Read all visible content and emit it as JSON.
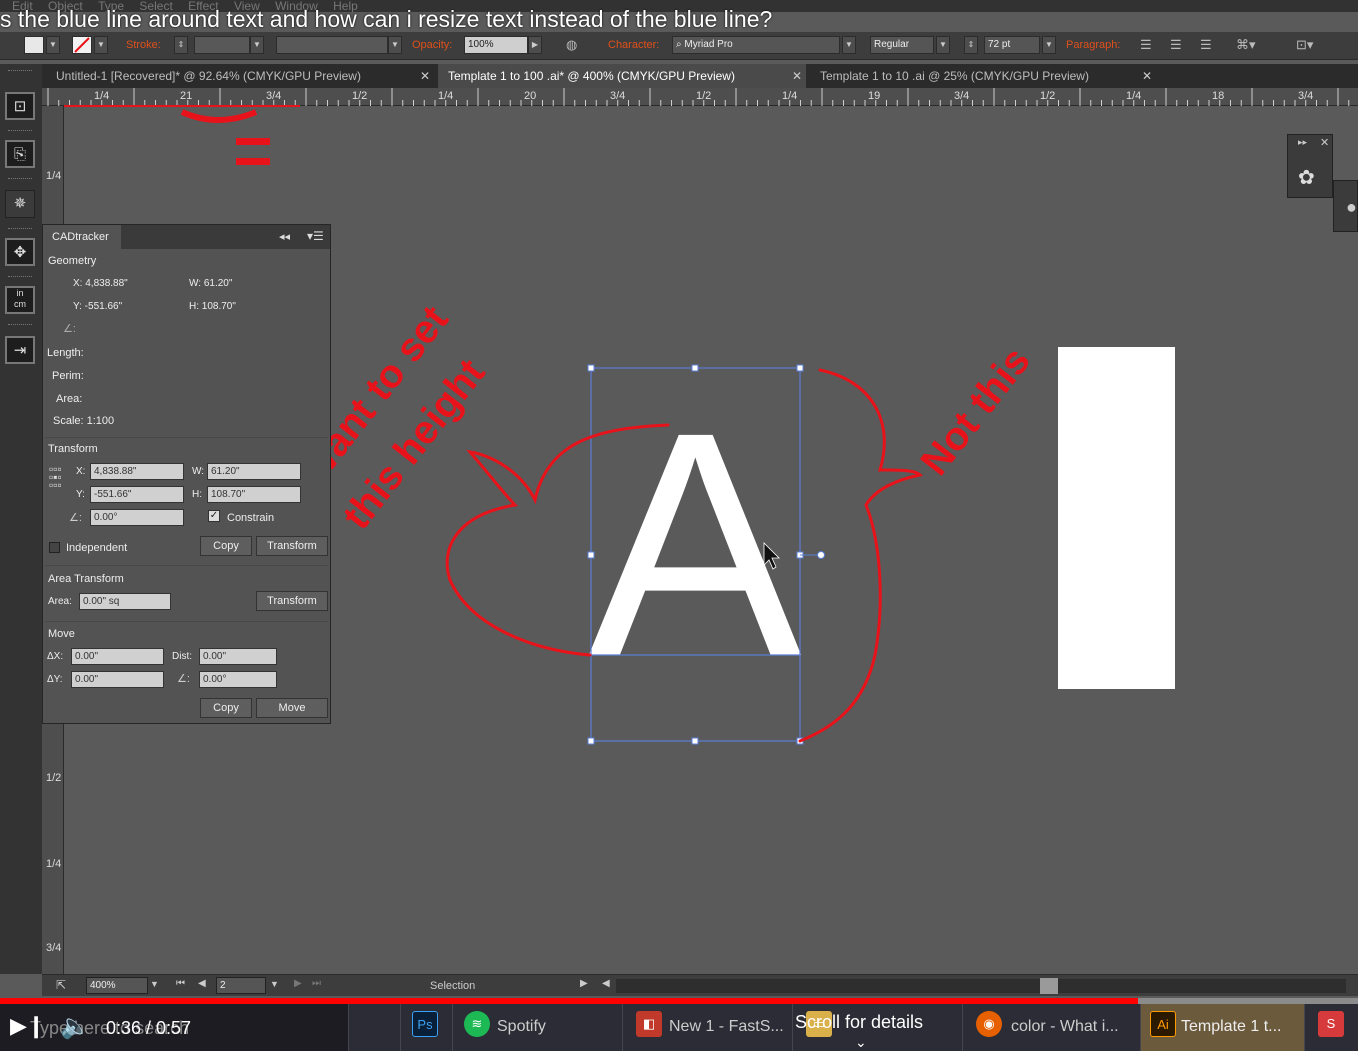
{
  "video": {
    "title": "s the blue line around text and how can i resize text instead of the blue line?",
    "time": "0:36 / 0:57",
    "scroll_hint": "Scroll for details",
    "typing_overlay": "Type here to search",
    "progress_fraction": 0.838
  },
  "menu": [
    "Edit",
    "Object",
    "Type",
    "Select",
    "Effect",
    "View",
    "Window",
    "Help"
  ],
  "control_bar": {
    "stroke_label": "Stroke:",
    "opacity_label": "Opacity:",
    "opacity_value": "100%",
    "character_label": "Character:",
    "font_name": "Myriad Pro",
    "font_style": "Regular",
    "font_size": "72 pt",
    "paragraph_label": "Paragraph:"
  },
  "tabs": [
    {
      "label": "Untitled-1 [Recovered]* @ 92.64% (CMYK/GPU Preview)",
      "active": false
    },
    {
      "label": "Template 1 to 100 .ai* @ 400% (CMYK/GPU Preview)",
      "active": true
    },
    {
      "label": "Template 1 to 10 .ai @ 25% (CMYK/GPU Preview)",
      "active": false
    }
  ],
  "ruler": {
    "h_labels": [
      "1/4",
      "21",
      "3/4",
      "1/2",
      "1/4",
      "20",
      "3/4",
      "1/2",
      "1/4",
      "19",
      "3/4",
      "1/2",
      "1/4",
      "18",
      "3/4"
    ],
    "v_labels": [
      "1/4",
      "1/2",
      "1/4",
      "3/4"
    ]
  },
  "cad_panel": {
    "title": "CADtracker",
    "geometry_label": "Geometry",
    "geo_x": "X: 4,838.88\"",
    "geo_w": "W: 61.20\"",
    "geo_y": "Y: -551.66\"",
    "geo_h": "H: 108.70\"",
    "angle_symbol": "∠:",
    "length_label": "Length:",
    "perim_label": "Perim:",
    "area_label": "Area:",
    "scale_label": "Scale: 1:100",
    "transform_label": "Transform",
    "x_label": "X:",
    "x_value": "4,838.88\"",
    "w_label": "W:",
    "w_value": "61.20\"",
    "y_label": "Y:",
    "y_value": "-551.66\"",
    "h_label": "H:",
    "h_value": "108.70\"",
    "angle_value": "0.00°",
    "constrain_label": "Constrain",
    "independent_label": "Independent",
    "copy_label": "Copy",
    "transform_button": "Transform",
    "area_transform_label": "Area Transform",
    "area_field_label": "Area:",
    "area_value": "0.00\" sq",
    "move_label": "Move",
    "dx_label": "ΔX:",
    "dx_value": "0.00\"",
    "dist_label": "Dist:",
    "dist_value": "0.00\"",
    "dy_label": "ΔY:",
    "dy_value": "0.00\"",
    "move_angle_value": "0.00°",
    "move_button": "Move"
  },
  "canvas": {
    "letter": "A",
    "annotation_left_1": "Want to set",
    "annotation_left_2": "this height",
    "annotation_right": "Not this"
  },
  "status_bar": {
    "zoom": "400%",
    "page": "2",
    "mode": "Selection"
  },
  "taskbar": {
    "spotify": "Spotify",
    "chrome": "New 1 - FastS...",
    "firefox": "color - What i...",
    "illustrator": "Template 1 t..."
  },
  "colors": {
    "annotation": "#e8131a",
    "selection": "#5b7fd6",
    "progress": "#ff0000"
  }
}
